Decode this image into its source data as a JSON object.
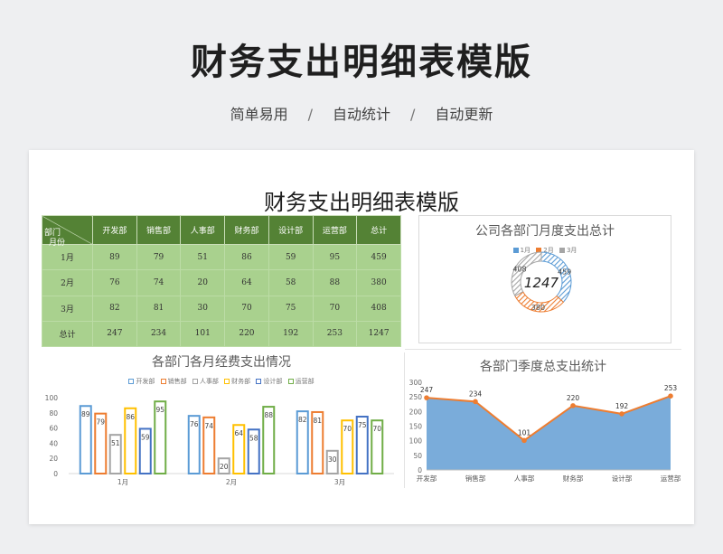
{
  "hero": {
    "title": "财务支出明细表模版",
    "features": [
      "简单易用",
      "自动统计",
      "自动更新"
    ],
    "separator": "/"
  },
  "sheet": {
    "title": "财务支出明细表模版",
    "table": {
      "corner_top": "部门",
      "corner_bottom": "月份",
      "columns": [
        "开发部",
        "销售部",
        "人事部",
        "财务部",
        "设计部",
        "运营部",
        "总计"
      ],
      "rows": [
        {
          "label": "1月",
          "values": [
            "89",
            "79",
            "51",
            "86",
            "59",
            "95",
            "459"
          ]
        },
        {
          "label": "2月",
          "values": [
            "76",
            "74",
            "20",
            "64",
            "58",
            "88",
            "380"
          ]
        },
        {
          "label": "3月",
          "values": [
            "82",
            "81",
            "30",
            "70",
            "75",
            "70",
            "408"
          ]
        },
        {
          "label": "总计",
          "values": [
            "247",
            "234",
            "101",
            "220",
            "192",
            "253",
            "1247"
          ]
        }
      ]
    }
  },
  "colors": {
    "header_green": "#548235",
    "cell_green": "#a9d18e",
    "jan": "#5b9bd5",
    "feb": "#ed7d31",
    "mar": "#a5a5a5",
    "apr": "#ffc000",
    "may": "#4472c4",
    "jun": "#70ad47",
    "area": "#6ba3d6",
    "line": "#ed7d31"
  },
  "chart_data": [
    {
      "type": "pie",
      "title": "公司各部门月度支出总计",
      "categories": [
        "1月",
        "2月",
        "3月"
      ],
      "values": [
        459,
        380,
        408
      ],
      "center_label": "1247",
      "legend": "top"
    },
    {
      "type": "bar",
      "title": "各部门各月经费支出情况",
      "categories": [
        "1月",
        "2月",
        "3月"
      ],
      "series": [
        {
          "name": "开发部",
          "values": [
            89,
            76,
            82
          ]
        },
        {
          "name": "销售部",
          "values": [
            79,
            74,
            81
          ]
        },
        {
          "name": "人事部",
          "values": [
            51,
            20,
            30
          ]
        },
        {
          "name": "财务部",
          "values": [
            86,
            64,
            70
          ]
        },
        {
          "name": "设计部",
          "values": [
            59,
            58,
            75
          ]
        },
        {
          "name": "运营部",
          "values": [
            95,
            88,
            70
          ]
        }
      ],
      "ylim": [
        0,
        100
      ],
      "yticks": [
        0,
        20,
        40,
        60,
        80,
        100
      ],
      "legend": "top",
      "grid": false
    },
    {
      "type": "area",
      "title": "各部门季度总支出统计",
      "categories": [
        "开发部",
        "销售部",
        "人事部",
        "财务部",
        "设计部",
        "运营部"
      ],
      "values": [
        247,
        234,
        101,
        220,
        192,
        253
      ],
      "ylim": [
        0,
        300
      ],
      "yticks": [
        0,
        50,
        100,
        150,
        200,
        250,
        300
      ],
      "grid": false
    }
  ]
}
